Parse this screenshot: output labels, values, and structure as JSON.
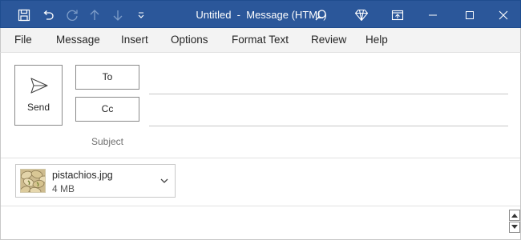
{
  "window": {
    "title_doc": "Untitled",
    "title_sep": "-",
    "title_kind": "Message (HTML)",
    "accent_color": "#2b579a"
  },
  "quick_access": {
    "icons": [
      "save-icon",
      "undo-icon",
      "redo-icon",
      "move-up-icon",
      "move-down-icon",
      "customize-chevron-icon"
    ]
  },
  "menu": {
    "items": [
      {
        "label": "File"
      },
      {
        "label": "Message"
      },
      {
        "label": "Insert"
      },
      {
        "label": "Options"
      },
      {
        "label": "Format Text"
      },
      {
        "label": "Review"
      },
      {
        "label": "Help"
      }
    ]
  },
  "compose": {
    "send_label": "Send",
    "to_label": "To",
    "cc_label": "Cc",
    "subject_label": "Subject",
    "to_value": "",
    "cc_value": "",
    "subject_value": ""
  },
  "attachment": {
    "name": "pistachios.jpg",
    "size": "4 MB"
  }
}
